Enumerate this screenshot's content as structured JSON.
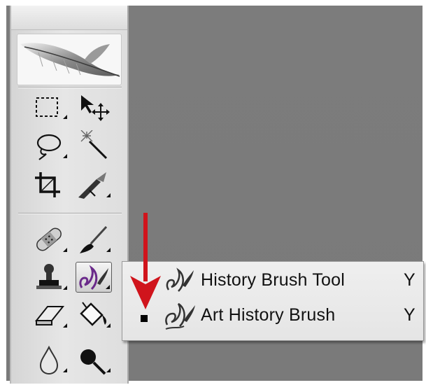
{
  "toolbar": {
    "tools": [
      {
        "name": "marquee-tool-icon",
        "flyout": true
      },
      {
        "name": "move-tool-icon",
        "flyout": false
      },
      {
        "name": "lasso-tool-icon",
        "flyout": true
      },
      {
        "name": "magic-wand-tool-icon",
        "flyout": false
      },
      {
        "name": "crop-tool-icon",
        "flyout": false
      },
      {
        "name": "slice-tool-icon",
        "flyout": true
      },
      {
        "name": "healing-brush-tool-icon",
        "flyout": true
      },
      {
        "name": "brush-tool-icon",
        "flyout": true
      },
      {
        "name": "clone-stamp-tool-icon",
        "flyout": true
      },
      {
        "name": "history-brush-tool-icon",
        "flyout": true,
        "active": true
      },
      {
        "name": "eraser-tool-icon",
        "flyout": true
      },
      {
        "name": "paint-bucket-tool-icon",
        "flyout": true
      },
      {
        "name": "blur-tool-icon",
        "flyout": true
      },
      {
        "name": "dodge-tool-icon",
        "flyout": true
      }
    ]
  },
  "flyout": {
    "items": [
      {
        "label": "History Brush Tool",
        "shortcut": "Y",
        "icon": "history-brush-icon",
        "selected": false
      },
      {
        "label": "Art History Brush",
        "shortcut": "Y",
        "icon": "art-history-brush-icon",
        "selected": true
      }
    ]
  },
  "colors": {
    "canvas": "#7b7b7b",
    "arrow": "#d0141c",
    "menu_background": "#ececec"
  }
}
